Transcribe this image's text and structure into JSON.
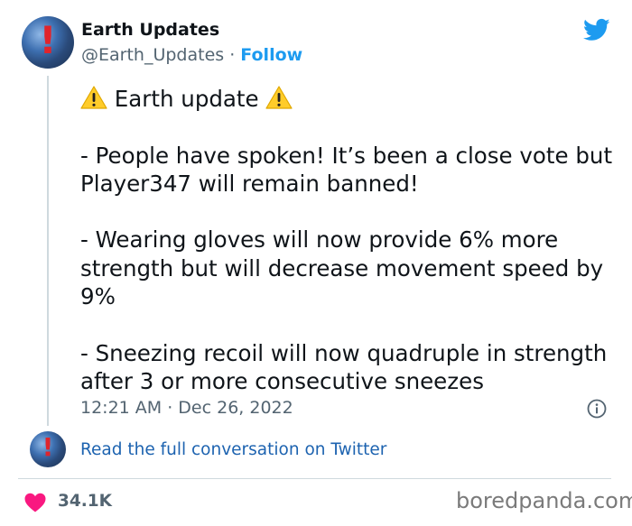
{
  "author": {
    "name": "Earth Updates",
    "handle": "@Earth_Updates",
    "separator": " · ",
    "follow_label": "Follow",
    "avatar_icon": "earth-globe-icon"
  },
  "tweet": {
    "header_text": "Earth update",
    "header_icon": "warning-emoji-icon",
    "paragraphs": [
      "- People have spoken! It’s been a close vote but Player347 will remain banned!",
      "- Wearing gloves will now provide 6% more strength but will decrease movement speed by 9%",
      "- Sneezing recoil will now quadruple in strength after 3 or more consecutive sneezes"
    ],
    "timestamp": "12:21 AM · Dec 26, 2022"
  },
  "conversation": {
    "link_text": "Read the full conversation on Twitter"
  },
  "engagement": {
    "likes": "34.1K"
  },
  "watermark": "boredpanda.com",
  "colors": {
    "twitter_blue": "#1d9bf0",
    "link_blue": "#1d63b0",
    "heart_pink": "#f91880",
    "secondary_text": "#536471"
  }
}
